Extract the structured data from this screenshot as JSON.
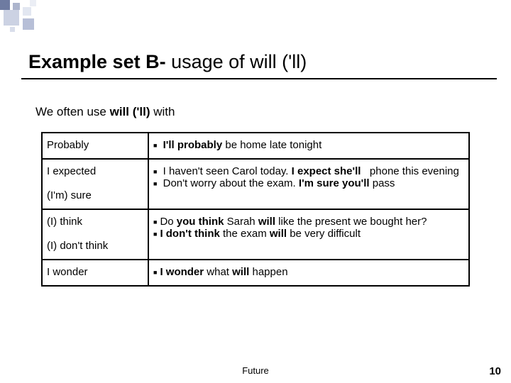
{
  "title": {
    "bold": "Example set B- ",
    "rest": "usage of will ('ll)"
  },
  "intro": {
    "pre": "We often use ",
    "bold": "will ('ll)",
    "post": " with"
  },
  "rows": [
    {
      "left": "Probably",
      "right_html": "<span class='bul'>■</span> <span class='b'>I'll probably</span> be home late tonight"
    },
    {
      "left_html": "I expected<br><br>(I'm) sure",
      "right_html": "<span class='bul'>■</span> I haven't seen Carol today. <span class='b'>I expect she'll</span> &nbsp; phone this evening<br><span class='bul'>■</span> Don't worry about the exam. <span class='b'>I'm sure you'll</span> pass"
    },
    {
      "left_html": "(I) think<br><br>(I) don't think",
      "right_html": "<span class='bul'>■</span>Do <span class='b'>you think</span> Sarah <span class='b'>will</span> like the present we bought her?<br><span class='bul'>■</span><span class='b'>I don't think</span> the exam <span class='b'>will</span> be very difficult"
    },
    {
      "left": "I wonder",
      "right_html": "<span class='bul'>■</span><span class='b'>I wonder</span> what <span class='b'>will</span> happen"
    }
  ],
  "footer": "Future",
  "page": "10"
}
